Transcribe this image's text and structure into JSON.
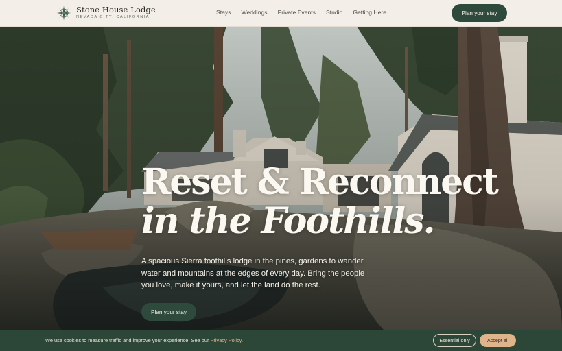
{
  "brand": {
    "name": "Stone House Lodge",
    "location": "NEVADA CITY, CALIFORNIA",
    "mark_icon": "compass-rose-icon"
  },
  "nav": {
    "items": [
      "Stays",
      "Weddings",
      "Private Events",
      "Studio",
      "Getting Here"
    ],
    "cta_label": "Plan your stay"
  },
  "hero": {
    "title_line1": "Reset & Reconnect",
    "title_line2": "in the Foothills.",
    "description": "A spacious Sierra foothills lodge in the pines, gardens to wander, water and mountains at the edges of every day. Bring the people you love, make it yours, and let the land do the rest.",
    "cta_label": "Plan your stay"
  },
  "cookie": {
    "text": "We use cookies to measure traffic and improve your experience. See our ",
    "link_label": "Privacy Policy",
    "text_end": ".",
    "essential_label": "Essential only",
    "accept_label": "Accept all"
  },
  "colors": {
    "primary": "#2e4a3c",
    "background": "#f3efe8",
    "accent": "#e0b48a"
  }
}
